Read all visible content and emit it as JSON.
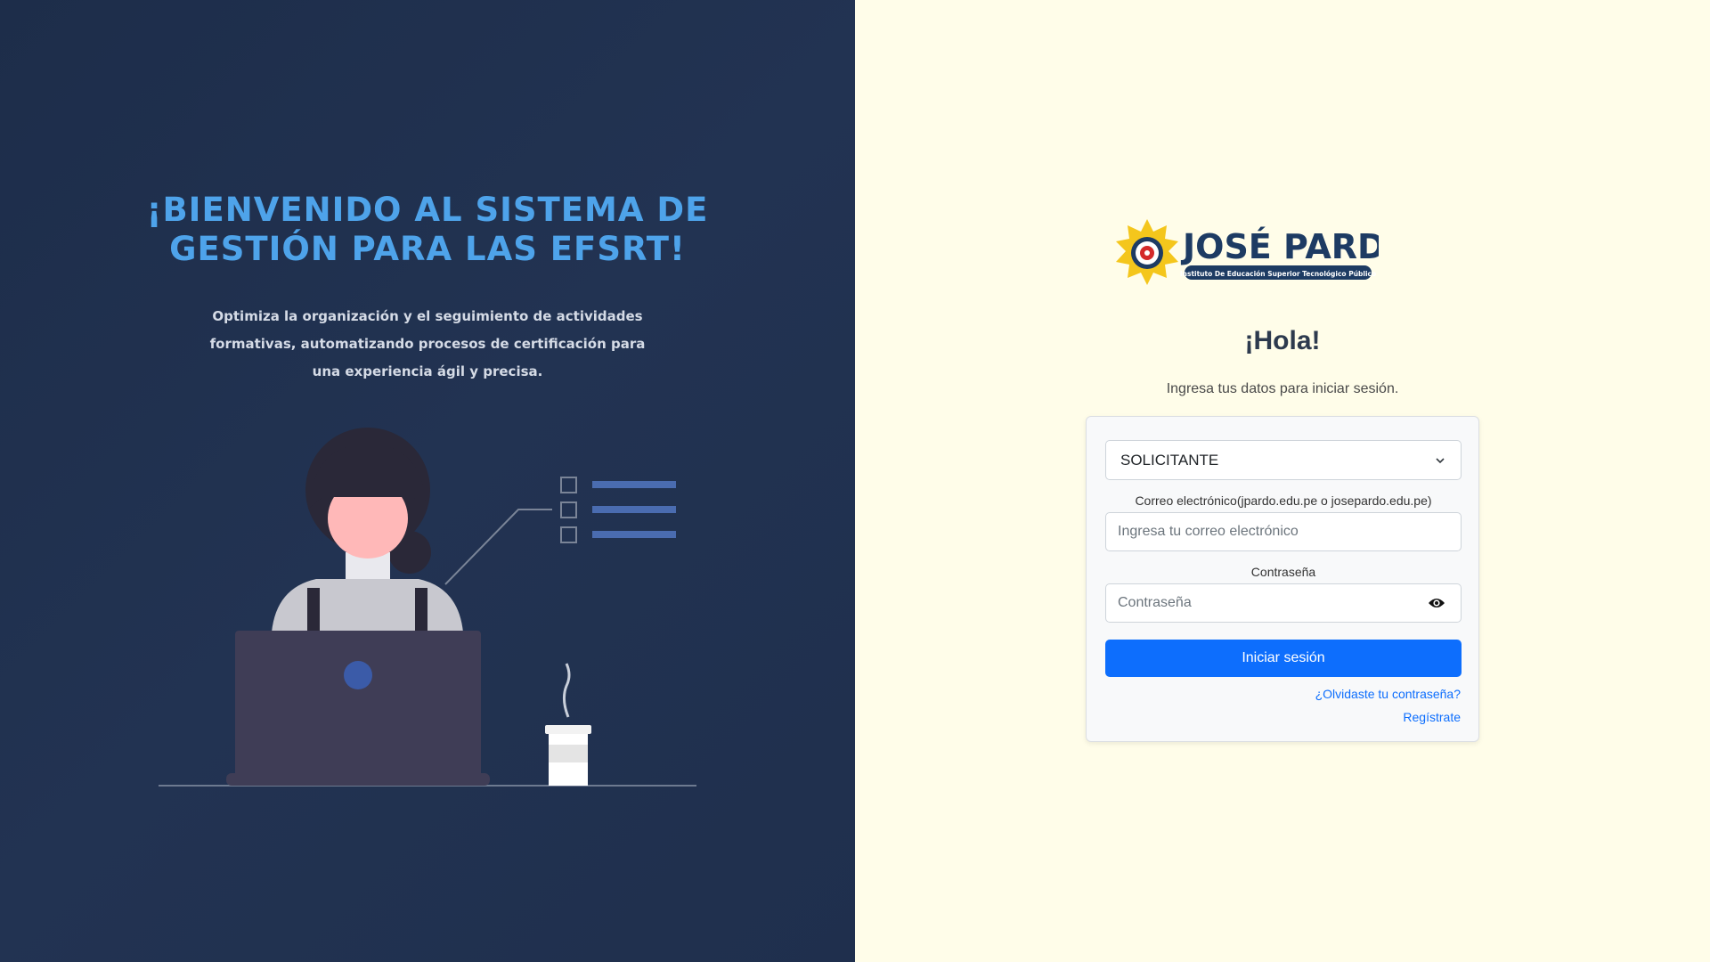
{
  "hero": {
    "title": "¡Bienvenido al sistema de gestión para las EFSRT!",
    "subtitle": "Optimiza la organización y el seguimiento de actividades formativas, automatizando procesos de certificación para una experiencia ágil y precisa."
  },
  "logo": {
    "name": "JOSÉ PARDO",
    "tagline": "Instituto De Educación Superior Tecnológico Público"
  },
  "login": {
    "greeting": "¡Hola!",
    "instruction": "Ingresa tus datos para iniciar sesión.",
    "role_selected": "SOLICITANTE",
    "email_label": "Correo electrónico(jpardo.edu.pe o josepardo.edu.pe)",
    "email_placeholder": "Ingresa tu correo electrónico",
    "password_label": "Contraseña",
    "password_placeholder": "Contraseña",
    "submit_label": "Iniciar sesión",
    "forgot_label": "¿Olvidaste tu contraseña?",
    "register_label": "Regístrate"
  },
  "colors": {
    "left_bg": "#1f2f4d",
    "right_bg": "#fffde9",
    "title_blue": "#4ea3ea",
    "primary": "#0d6efd"
  }
}
